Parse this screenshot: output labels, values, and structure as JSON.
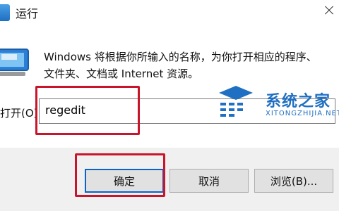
{
  "window": {
    "title": "运行"
  },
  "description": {
    "line1": "Windows 将根据你所输入的名称，为你打开相应的程序、",
    "line2": "文件夹、文档或 Internet 资源。"
  },
  "open_field": {
    "label": "打开(O):",
    "value": "regedit"
  },
  "buttons": {
    "ok": "确定",
    "cancel": "取消",
    "browse": "浏览(B)..."
  },
  "watermark": {
    "title": "系统之家",
    "subtitle": "XITONGZHIJIA.NET"
  },
  "colors": {
    "highlight": "#c9152b",
    "accent": "#1f6fc2"
  }
}
